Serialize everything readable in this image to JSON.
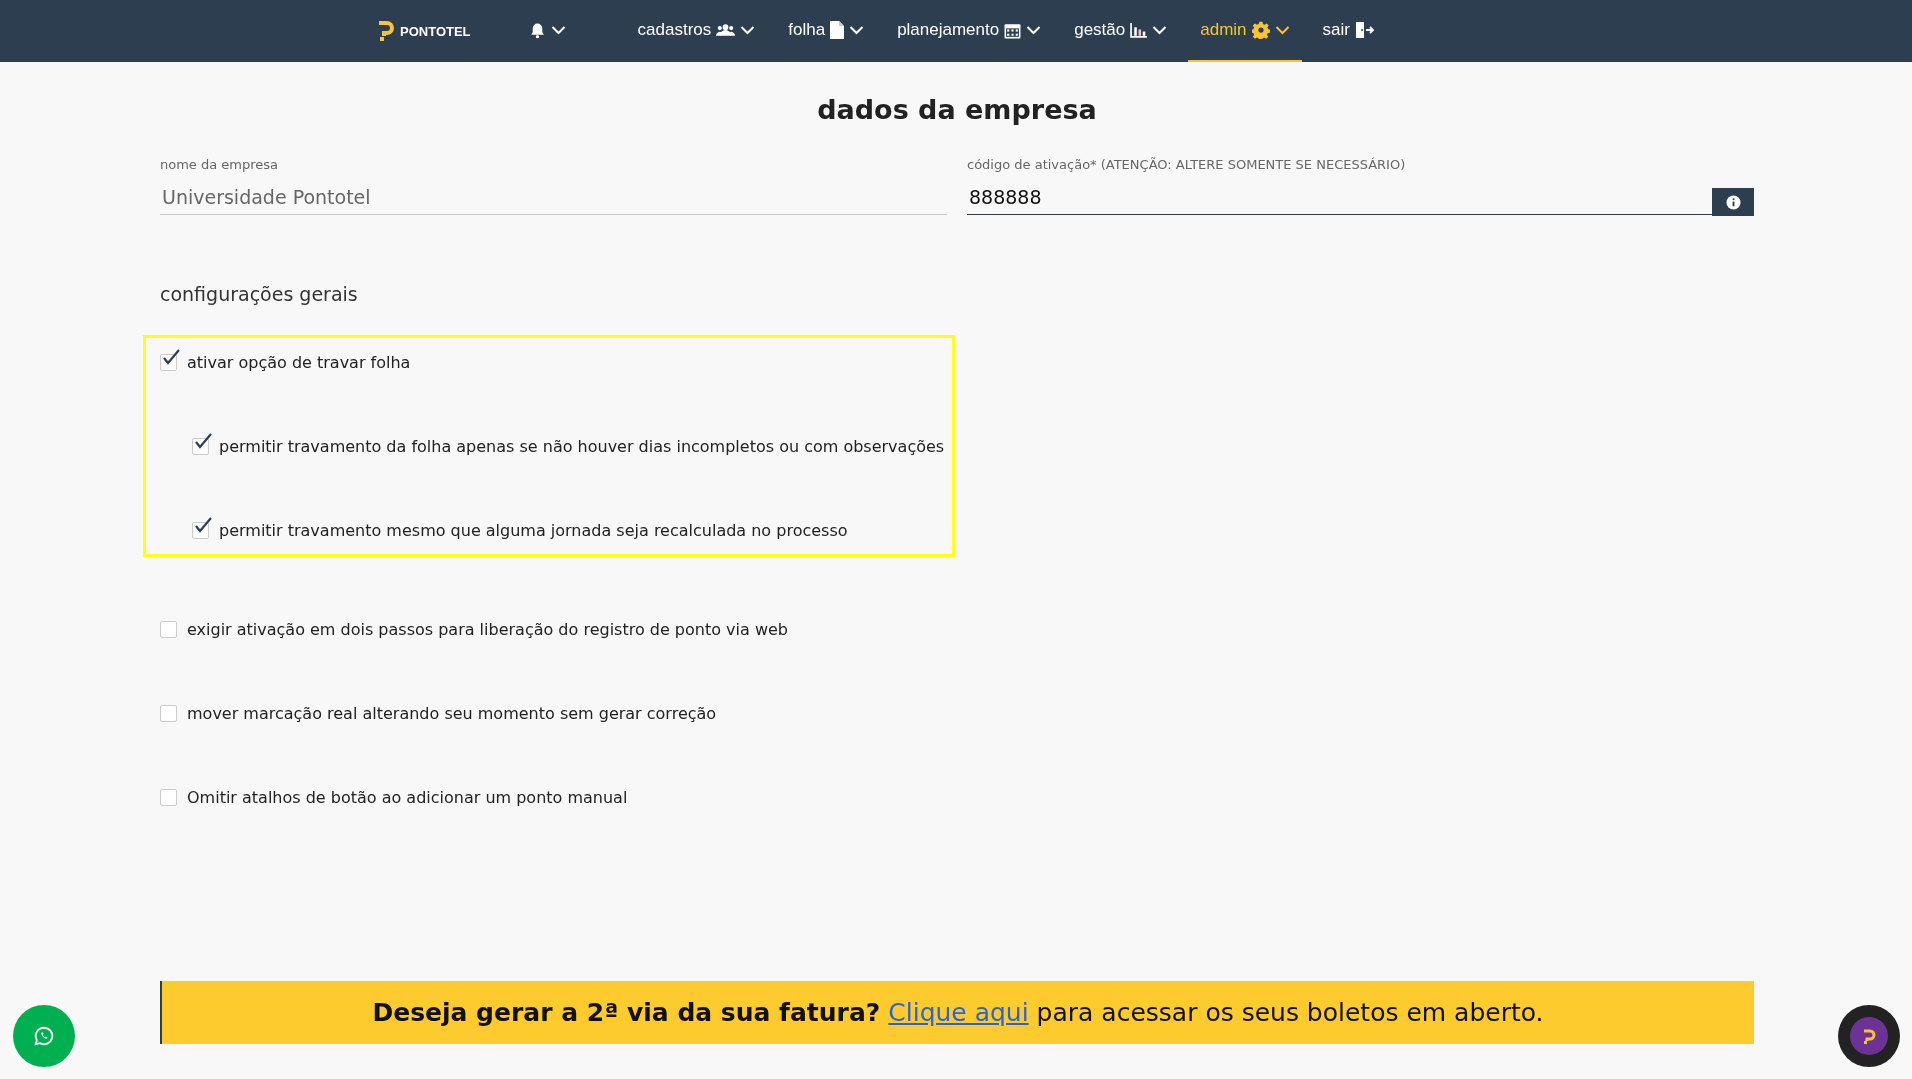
{
  "navbar": {
    "logo": "PONTOTEL",
    "items": [
      {
        "has_menu": true,
        "selected": false
      },
      {
        "label": "cadastros",
        "has_menu": true,
        "selected": false
      },
      {
        "label": "folha",
        "has_menu": true,
        "selected": false
      },
      {
        "label": "planejamento",
        "has_menu": true,
        "selected": false
      },
      {
        "label": "gestão",
        "has_menu": true,
        "selected": false
      },
      {
        "label": "admin",
        "has_menu": true,
        "selected": true
      },
      {
        "label": "sair",
        "has_menu": false,
        "selected": false
      }
    ]
  },
  "page_title": "dados da empresa",
  "fields": [
    {
      "label": "nome da empresa",
      "value": "Universidade Pontotel",
      "disabled": true,
      "info_button": false
    },
    {
      "label": "código de ativação* (ATENÇÃO: ALTERE SOMENTE SE NECESSÁRIO)",
      "value": "888888",
      "disabled": false,
      "info_button": true
    }
  ],
  "section_title": "configurações gerais",
  "settings": [
    {
      "label": "ativar opção de travar folha",
      "checked": true,
      "highlighted": true,
      "children": [
        {
          "label": "permitir travamento da folha apenas se não houver dias incompletos ou com observações",
          "checked": true
        },
        {
          "label": "permitir travamento mesmo que alguma jornada seja recalculada no processo",
          "checked": true
        }
      ]
    },
    {
      "label": "exigir ativação em dois passos para liberação do registro de ponto via web",
      "checked": false,
      "highlighted": false
    },
    {
      "label": "mover marcação real alterando seu momento sem gerar correção",
      "checked": false,
      "highlighted": false
    },
    {
      "label": "Omitir atalhos de botão ao adicionar um ponto manual",
      "checked": false,
      "highlighted": false
    }
  ],
  "banner": {
    "lead": "Deseja gerar a 2ª via da sua fatura?",
    "link": "Clique aqui",
    "rest": "para acessar os seus boletos em aberto."
  }
}
